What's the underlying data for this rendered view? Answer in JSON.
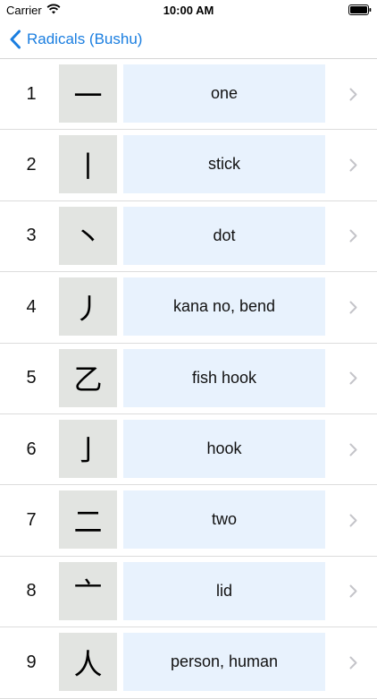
{
  "status_bar": {
    "carrier": "Carrier",
    "time": "10:00 AM"
  },
  "nav": {
    "back_label": "Radicals (Bushu)",
    "accent_color": "#1a7ee0"
  },
  "radicals": [
    {
      "number": "1",
      "glyph": "一",
      "meaning": "one"
    },
    {
      "number": "2",
      "glyph": "丨",
      "meaning": "stick"
    },
    {
      "number": "3",
      "glyph": "丶",
      "meaning": "dot"
    },
    {
      "number": "4",
      "glyph": "丿",
      "meaning": "kana no, bend"
    },
    {
      "number": "5",
      "glyph": "乙",
      "meaning": "fish hook"
    },
    {
      "number": "6",
      "glyph": "亅",
      "meaning": "hook"
    },
    {
      "number": "7",
      "glyph": "二",
      "meaning": "two"
    },
    {
      "number": "8",
      "glyph": "亠",
      "meaning": "lid"
    },
    {
      "number": "9",
      "glyph": "人",
      "meaning": "person, human"
    }
  ],
  "icons": {
    "back": "chevron-left-icon",
    "disclosure": "chevron-right-icon",
    "wifi": "wifi-icon",
    "battery": "battery-icon"
  }
}
